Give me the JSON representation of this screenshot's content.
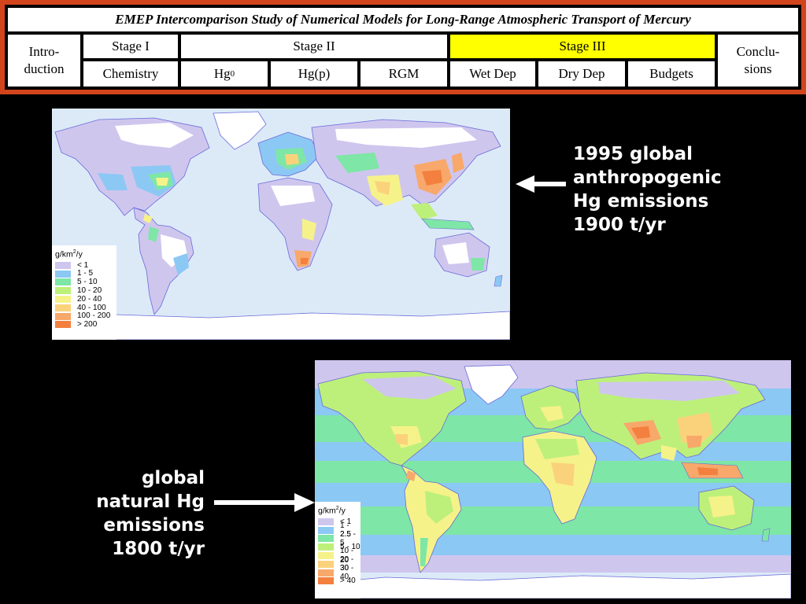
{
  "nav": {
    "title": "EMEP Intercomparison Study of Numerical Models for Long-Range Atmospheric Transport of Mercury",
    "introduction": "Intro-\nduction",
    "stage1": "Stage I",
    "stage1_items": [
      "Chemistry"
    ],
    "stage2": "Stage II",
    "stage2_items": [
      "Hg",
      "Hg(p)",
      "RGM"
    ],
    "stage2_hg_sup": "0",
    "stage3": "Stage III",
    "stage3_items": [
      "Wet Dep",
      "Dry Dep",
      "Budgets"
    ],
    "conclusions": "Conclu-\nsions",
    "active_stage": "Stage III",
    "active_color": "#ffff00",
    "frame_color": "#d2441c"
  },
  "maps": {
    "anthropogenic": {
      "legend_title": "g/km",
      "legend_sup": "2",
      "legend_suffix": "/y",
      "legend": [
        {
          "label": "< 1",
          "color": "#cfc6ee"
        },
        {
          "label": "1 - 5",
          "color": "#8cc8f4"
        },
        {
          "label": "5 - 10",
          "color": "#7ee6a6"
        },
        {
          "label": "10 - 20",
          "color": "#bdf07a"
        },
        {
          "label": "20 - 40",
          "color": "#f6f28a"
        },
        {
          "label": "40 - 100",
          "color": "#fbd27c"
        },
        {
          "label": "100 - 200",
          "color": "#f8a86a"
        },
        {
          "label": "> 200",
          "color": "#f3803e"
        }
      ]
    },
    "natural": {
      "legend_title": "g/km",
      "legend_sup": "2",
      "legend_suffix": "/y",
      "legend": [
        {
          "label": "< 1",
          "color": "#cfc6ee"
        },
        {
          "label": "1 - 2.5",
          "color": "#8cc8f4"
        },
        {
          "label": "2.5 - 5",
          "color": "#7ee6a6"
        },
        {
          "label": "5 - 10",
          "color": "#bdf07a"
        },
        {
          "label": "10 - 20",
          "color": "#f6f28a"
        },
        {
          "label": "20 - 30",
          "color": "#fbd27c"
        },
        {
          "label": "30 - 40",
          "color": "#f8a86a"
        },
        {
          "label": "> 40",
          "color": "#f3803e"
        }
      ]
    }
  },
  "notes": {
    "anthropogenic": [
      "1995 global",
      "anthropogenic",
      "Hg emissions",
      "1900 t/yr"
    ],
    "natural": [
      "global",
      "natural Hg",
      "emissions",
      "1800 t/yr"
    ]
  }
}
